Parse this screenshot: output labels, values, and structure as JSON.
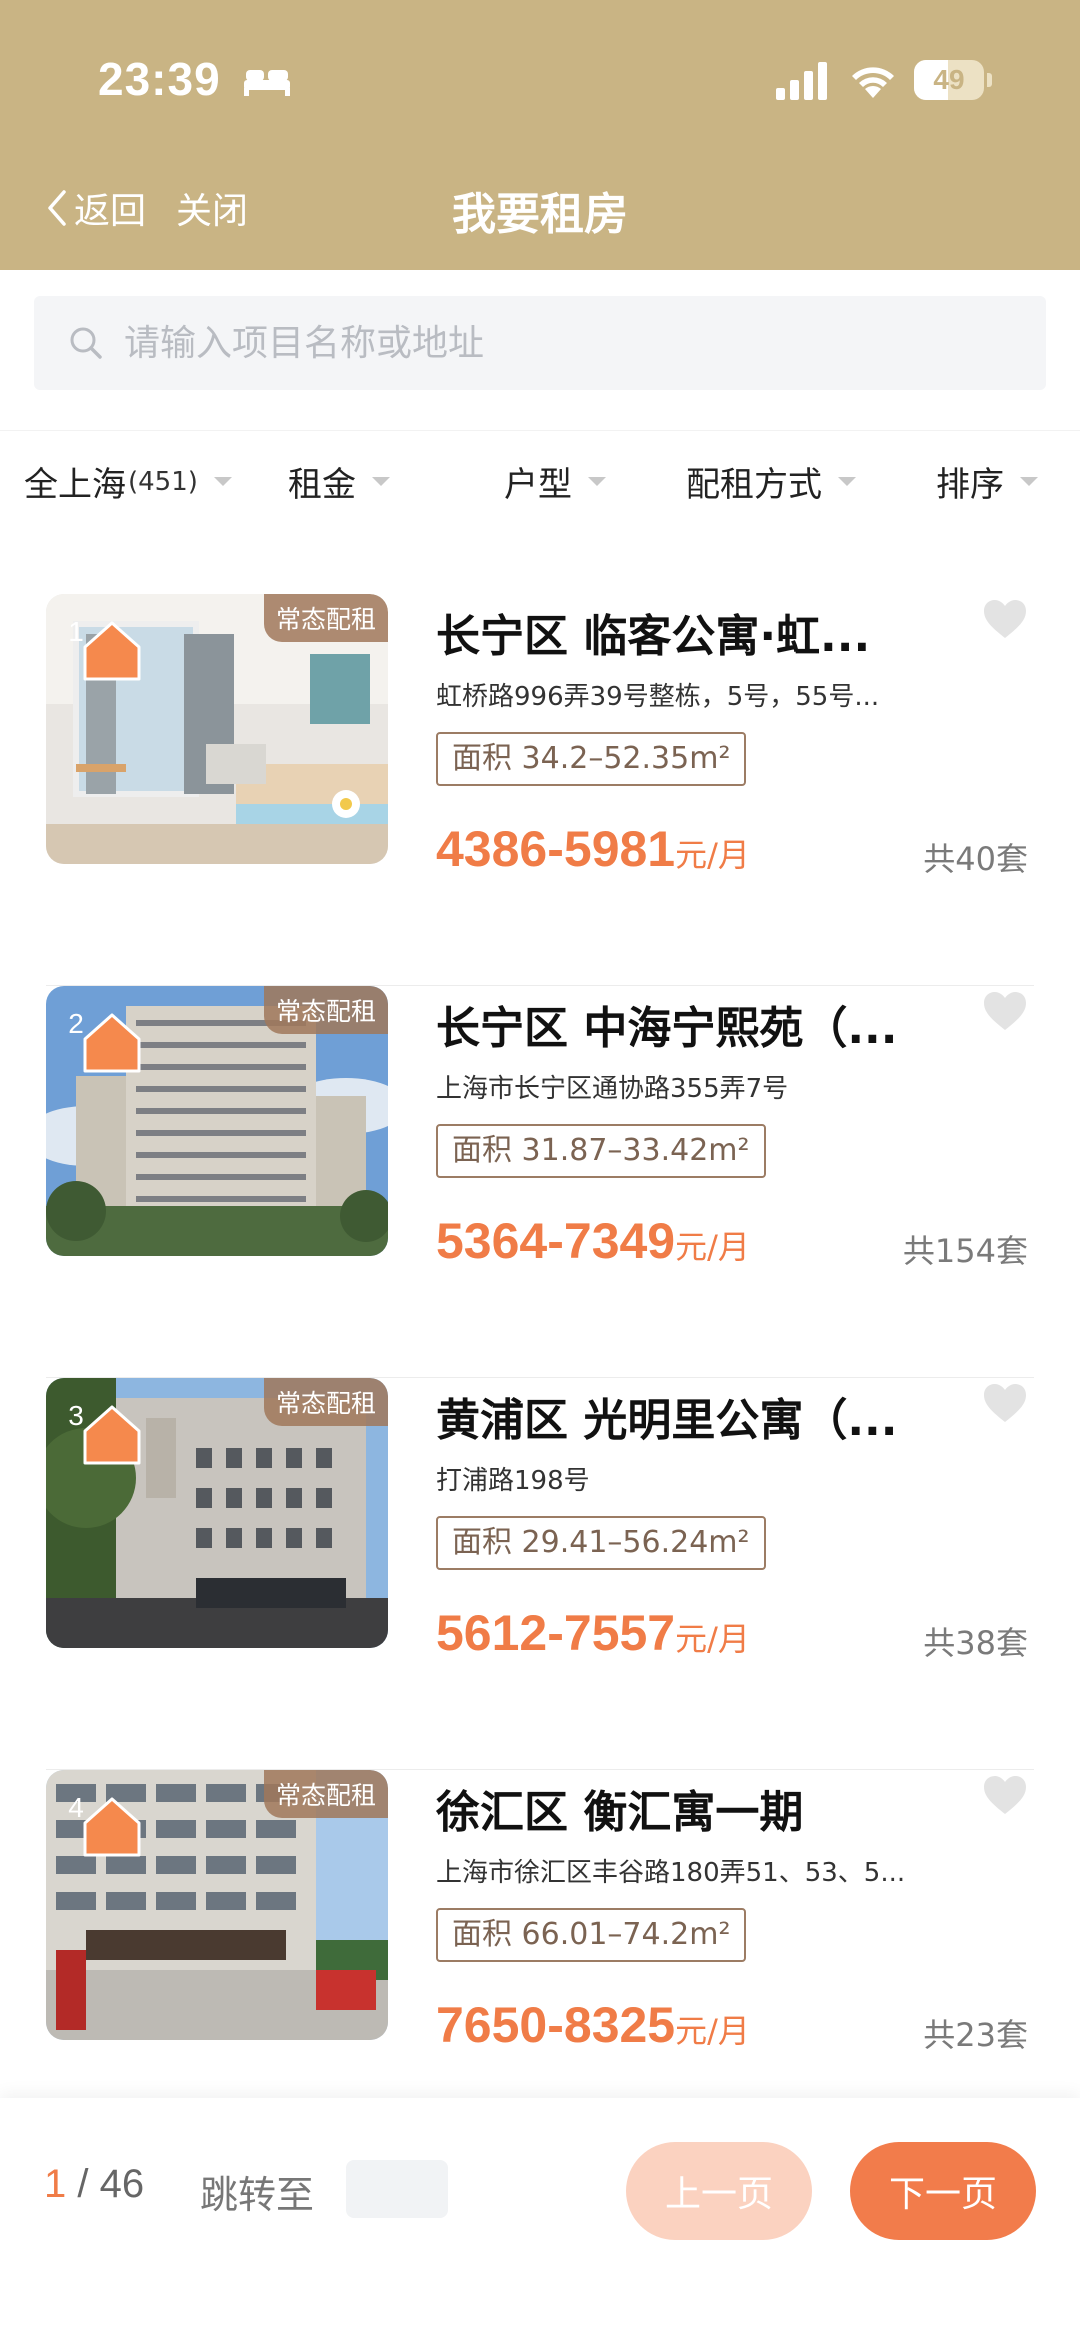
{
  "status_bar": {
    "time": "23:39",
    "battery": "49"
  },
  "nav": {
    "back": "返回",
    "close": "关闭",
    "title": "我要租房"
  },
  "search": {
    "placeholder": "请输入项目名称或地址"
  },
  "filters": [
    {
      "label": "全上海",
      "count": "(451)"
    },
    {
      "label": "租金"
    },
    {
      "label": "户型"
    },
    {
      "label": "配租方式"
    },
    {
      "label": "排序"
    }
  ],
  "listings": [
    {
      "rank": "1",
      "tag": "常态配租",
      "title": "长宁区 临客公寓·虹...",
      "address": "虹桥路996弄39号整栋，5号，55号...",
      "area": "面积 34.2–52.35m²",
      "price": "4386-5981",
      "unit": "元/月",
      "total": "共40套"
    },
    {
      "rank": "2",
      "tag": "常态配租",
      "title": "长宁区 中海宁熙苑（...",
      "address": "上海市长宁区通协路355弄7号",
      "area": "面积 31.87–33.42m²",
      "price": "5364-7349",
      "unit": "元/月",
      "total": "共154套"
    },
    {
      "rank": "3",
      "tag": "常态配租",
      "title": "黄浦区 光明里公寓（...",
      "address": "打浦路198号",
      "area": "面积 29.41–56.24m²",
      "price": "5612-7557",
      "unit": "元/月",
      "total": "共38套"
    },
    {
      "rank": "4",
      "tag": "常态配租",
      "title": "徐汇区 衡汇寓一期",
      "address": "上海市徐汇区丰谷路180弄51、53、5...",
      "area": "面积 66.01–74.2m²",
      "price": "7650-8325",
      "unit": "元/月",
      "total": "共23套"
    }
  ],
  "pagination": {
    "current": "1",
    "separator": " / ",
    "total": "46",
    "jump_label": "跳转至",
    "prev": "上一页",
    "next": "下一页"
  },
  "colors": {
    "header": "#c9b484",
    "accent": "#f07c47"
  }
}
